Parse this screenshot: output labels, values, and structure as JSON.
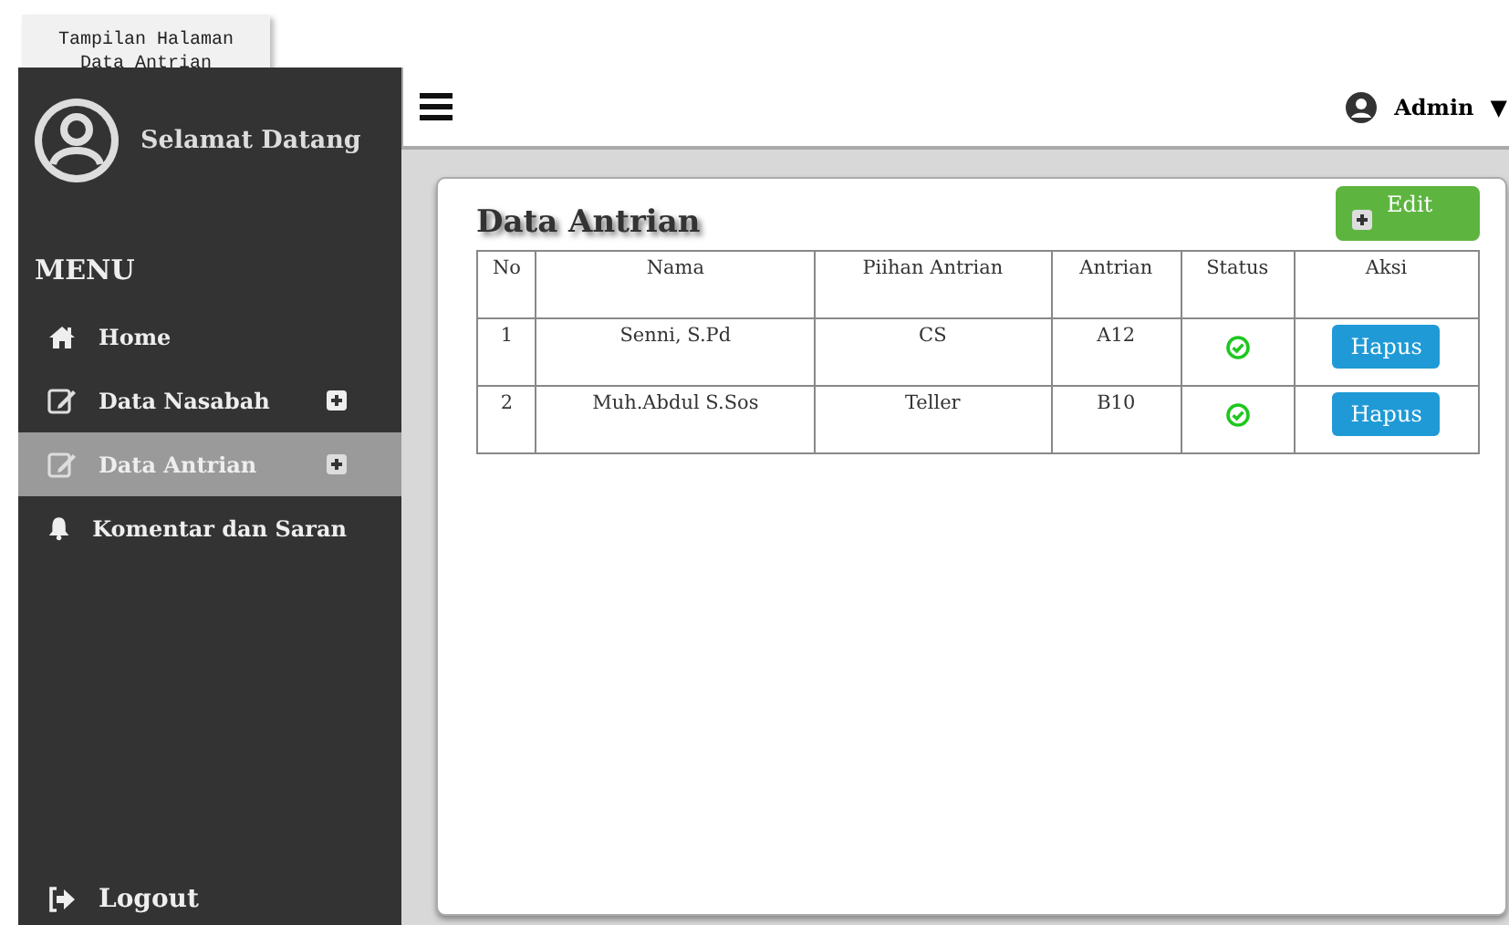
{
  "note": {
    "lines": [
      "Tampilan Halaman",
      "Data Antrian"
    ]
  },
  "sidebar": {
    "greeting": "Selamat Datang",
    "menu_title": "MENU",
    "items": [
      {
        "label": "Home",
        "selected": false,
        "submenu": false
      },
      {
        "label": "Data Nasabah",
        "selected": false,
        "submenu": true
      },
      {
        "label": "Data Antrian",
        "selected": true,
        "submenu": true
      },
      {
        "label": "Komentar dan Saran",
        "selected": false,
        "submenu": false
      }
    ],
    "logout": "Logout"
  },
  "topbar": {
    "user": "Admin",
    "caret": "▼"
  },
  "card": {
    "title": "Data Antrian",
    "edit_button": "Edit",
    "table": {
      "columns": [
        "No",
        "Nama",
        "Piihan Antrian",
        "Antrian",
        "Status",
        "Aksi"
      ],
      "rows": [
        {
          "no": "1",
          "nama": "Senni, S.Pd",
          "pilihan": "CS",
          "antrian": "A12",
          "action": "Hapus"
        },
        {
          "no": "2",
          "nama": "Muh.Abdul S.Sos",
          "pilihan": "Teller",
          "antrian": "B10",
          "action": "Hapus"
        }
      ]
    }
  }
}
